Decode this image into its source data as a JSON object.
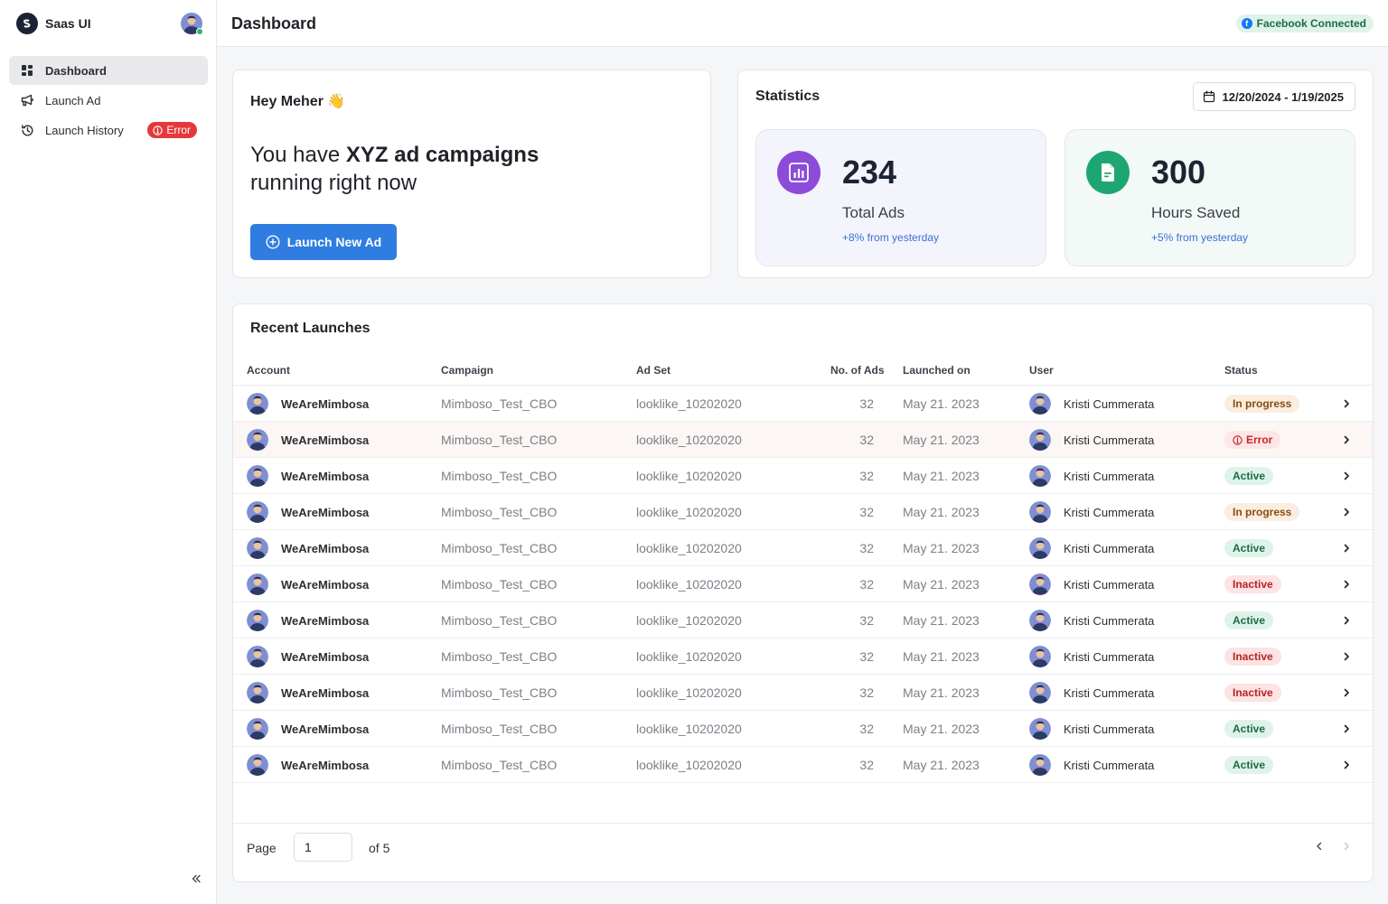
{
  "app": {
    "name": "Saas UI"
  },
  "sidebar": {
    "items": [
      {
        "label": "Dashboard",
        "icon": "dashboard-grid-icon",
        "active": true
      },
      {
        "label": "Launch Ad",
        "icon": "megaphone-icon",
        "active": false
      },
      {
        "label": "Launch History",
        "icon": "history-clock-icon",
        "active": false,
        "badge": "Error"
      }
    ]
  },
  "header": {
    "title": "Dashboard",
    "connection_badge": "Facebook Connected"
  },
  "greeting": {
    "title": "Hey Meher",
    "emoji": "👋",
    "headline_pre": "You have ",
    "headline_bold": "XYZ ad campaigns",
    "headline_post": " running right now",
    "button_label": "Launch New Ad"
  },
  "statistics": {
    "title": "Statistics",
    "date_range": "12/20/2024 - 1/19/2025",
    "cards": [
      {
        "value": "234",
        "label": "Total Ads",
        "delta": "+8% from yesterday",
        "color": "#8c4bd9"
      },
      {
        "value": "300",
        "label": "Hours Saved",
        "delta": "+5% from yesterday",
        "color": "#1ea672"
      }
    ]
  },
  "recent": {
    "title": "Recent Launches",
    "columns": [
      "Account",
      "Campaign",
      "Ad Set",
      "No. of Ads",
      "Launched on",
      "User",
      "Status"
    ],
    "rows": [
      {
        "account": "WeAreMimbosa",
        "campaign": "Mimboso_Test_CBO",
        "adset": "looklike_10202020",
        "ads": "32",
        "date": "May 21. 2023",
        "user": "Kristi Cummerata",
        "status": "In progress"
      },
      {
        "account": "WeAreMimbosa",
        "campaign": "Mimboso_Test_CBO",
        "adset": "looklike_10202020",
        "ads": "32",
        "date": "May 21. 2023",
        "user": "Kristi Cummerata",
        "status": "Error"
      },
      {
        "account": "WeAreMimbosa",
        "campaign": "Mimboso_Test_CBO",
        "adset": "looklike_10202020",
        "ads": "32",
        "date": "May 21. 2023",
        "user": "Kristi Cummerata",
        "status": "Active"
      },
      {
        "account": "WeAreMimbosa",
        "campaign": "Mimboso_Test_CBO",
        "adset": "looklike_10202020",
        "ads": "32",
        "date": "May 21. 2023",
        "user": "Kristi Cummerata",
        "status": "In progress"
      },
      {
        "account": "WeAreMimbosa",
        "campaign": "Mimboso_Test_CBO",
        "adset": "looklike_10202020",
        "ads": "32",
        "date": "May 21. 2023",
        "user": "Kristi Cummerata",
        "status": "Active"
      },
      {
        "account": "WeAreMimbosa",
        "campaign": "Mimboso_Test_CBO",
        "adset": "looklike_10202020",
        "ads": "32",
        "date": "May 21. 2023",
        "user": "Kristi Cummerata",
        "status": "Inactive"
      },
      {
        "account": "WeAreMimbosa",
        "campaign": "Mimboso_Test_CBO",
        "adset": "looklike_10202020",
        "ads": "32",
        "date": "May 21. 2023",
        "user": "Kristi Cummerata",
        "status": "Active"
      },
      {
        "account": "WeAreMimbosa",
        "campaign": "Mimboso_Test_CBO",
        "adset": "looklike_10202020",
        "ads": "32",
        "date": "May 21. 2023",
        "user": "Kristi Cummerata",
        "status": "Inactive"
      },
      {
        "account": "WeAreMimbosa",
        "campaign": "Mimboso_Test_CBO",
        "adset": "looklike_10202020",
        "ads": "32",
        "date": "May 21. 2023",
        "user": "Kristi Cummerata",
        "status": "Inactive"
      },
      {
        "account": "WeAreMimbosa",
        "campaign": "Mimboso_Test_CBO",
        "adset": "looklike_10202020",
        "ads": "32",
        "date": "May 21. 2023",
        "user": "Kristi Cummerata",
        "status": "Active"
      },
      {
        "account": "WeAreMimbosa",
        "campaign": "Mimboso_Test_CBO",
        "adset": "looklike_10202020",
        "ads": "32",
        "date": "May 21. 2023",
        "user": "Kristi Cummerata",
        "status": "Active"
      }
    ],
    "status_styles": {
      "In progress": {
        "bg": "#fbeee0",
        "fg": "#8a4b12"
      },
      "Error": {
        "bg": "#fde6e6",
        "fg": "#c62828"
      },
      "Active": {
        "bg": "#dff3ea",
        "fg": "#1d6b48"
      },
      "Inactive": {
        "bg": "#fde3e3",
        "fg": "#b42323"
      }
    }
  },
  "pagination": {
    "label": "Page",
    "current": "1",
    "of_label": "of 5"
  }
}
